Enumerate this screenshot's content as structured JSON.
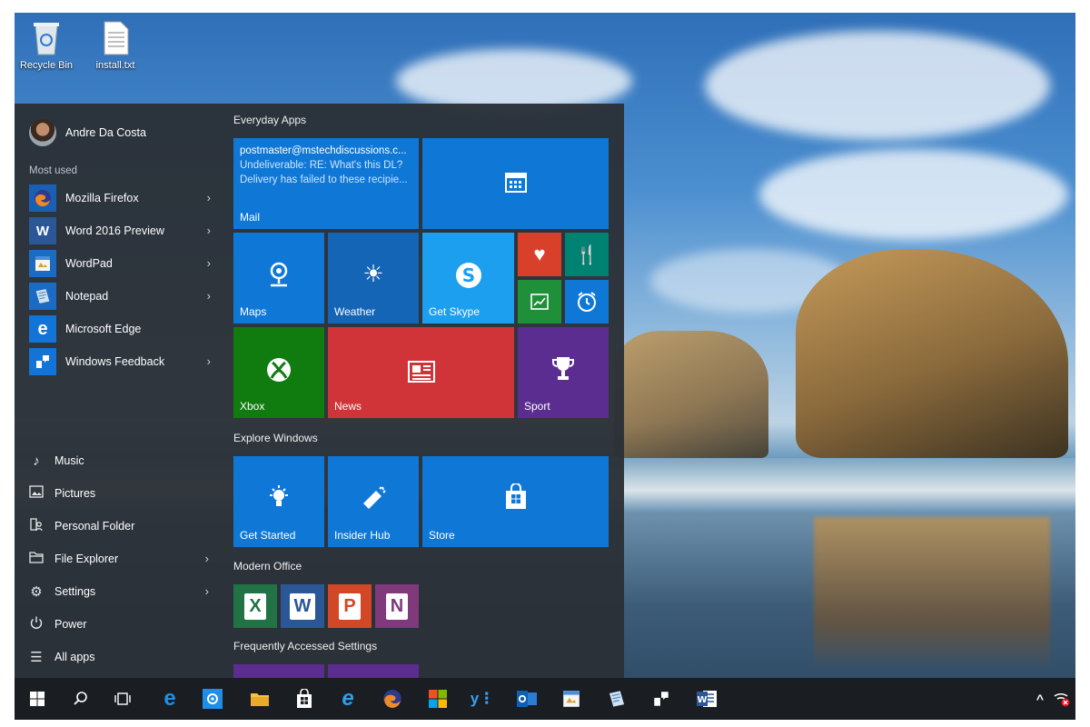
{
  "desktop": {
    "icons": [
      {
        "label": "Recycle Bin",
        "icon": "recycle-bin-icon"
      },
      {
        "label": "install.txt",
        "icon": "text-file-icon"
      }
    ]
  },
  "start_menu": {
    "user": {
      "name": "Andre Da Costa",
      "icon": "avatar"
    },
    "most_used_label": "Most used",
    "most_used": [
      {
        "label": "Mozilla Firefox",
        "icon": "firefox-icon",
        "has_arrow": true
      },
      {
        "label": "Word 2016 Preview",
        "icon": "word-icon",
        "has_arrow": true
      },
      {
        "label": "WordPad",
        "icon": "wordpad-icon",
        "has_arrow": true
      },
      {
        "label": "Notepad",
        "icon": "notepad-icon",
        "has_arrow": true
      },
      {
        "label": "Microsoft Edge",
        "icon": "edge-icon",
        "has_arrow": false
      },
      {
        "label": "Windows Feedback",
        "icon": "feedback-icon",
        "has_arrow": true
      }
    ],
    "places": [
      {
        "label": "Music",
        "icon": "music-note-icon",
        "has_arrow": false
      },
      {
        "label": "Pictures",
        "icon": "pictures-icon",
        "has_arrow": false
      },
      {
        "label": "Personal Folder",
        "icon": "personal-folder-icon",
        "has_arrow": false
      },
      {
        "label": "File Explorer",
        "icon": "file-explorer-icon",
        "has_arrow": true
      },
      {
        "label": "Settings",
        "icon": "gear-icon",
        "has_arrow": true
      },
      {
        "label": "Power",
        "icon": "power-icon",
        "has_arrow": false
      },
      {
        "label": "All apps",
        "icon": "all-apps-icon",
        "has_arrow": false
      }
    ],
    "groups": {
      "everyday": "Everyday Apps",
      "explore": "Explore Windows",
      "office": "Modern Office",
      "settings": "Frequently Accessed Settings"
    },
    "mail_tile": {
      "from": "postmaster@mstechdiscussions.c...",
      "subject": "Undeliverable: RE: What's this DL?",
      "preview": "Delivery has failed to these recipie...",
      "name": "Mail"
    },
    "tiles": {
      "maps": "Maps",
      "weather": "Weather",
      "skype": "Get Skype",
      "xbox": "Xbox",
      "news": "News",
      "sport": "Sport",
      "get_started": "Get Started",
      "insider_hub": "Insider Hub",
      "store": "Store"
    },
    "office_apps": [
      {
        "letter": "X",
        "icon": "excel-icon",
        "color": "#217346"
      },
      {
        "letter": "W",
        "icon": "word-icon",
        "color": "#2b5797"
      },
      {
        "letter": "P",
        "icon": "powerpoint-icon",
        "color": "#d24726"
      },
      {
        "letter": "N",
        "icon": "onenote-icon",
        "color": "#80397b"
      }
    ]
  },
  "colors": {
    "tile_blue": "#0f78d7",
    "tile_dark_blue": "#1565b7",
    "skype_blue": "#1d9ff0",
    "xbox_green": "#107c10",
    "news_red": "#d13438",
    "sport_purple": "#5c2d91",
    "taskbar": "#1a1d21"
  },
  "taskbar": [
    {
      "icon": "windows-start-icon"
    },
    {
      "icon": "search-icon"
    },
    {
      "icon": "task-view-icon"
    },
    {
      "icon": "edge-icon"
    },
    {
      "icon": "app-icon"
    },
    {
      "icon": "file-explorer-icon"
    },
    {
      "icon": "store-icon"
    },
    {
      "icon": "internet-explorer-icon"
    },
    {
      "icon": "firefox-icon"
    },
    {
      "icon": "windows-logo-icon"
    },
    {
      "icon": "yammer-icon"
    },
    {
      "icon": "outlook-icon"
    },
    {
      "icon": "wordpad-icon"
    },
    {
      "icon": "notepad-icon"
    },
    {
      "icon": "feedback-icon"
    },
    {
      "icon": "word-icon"
    }
  ]
}
